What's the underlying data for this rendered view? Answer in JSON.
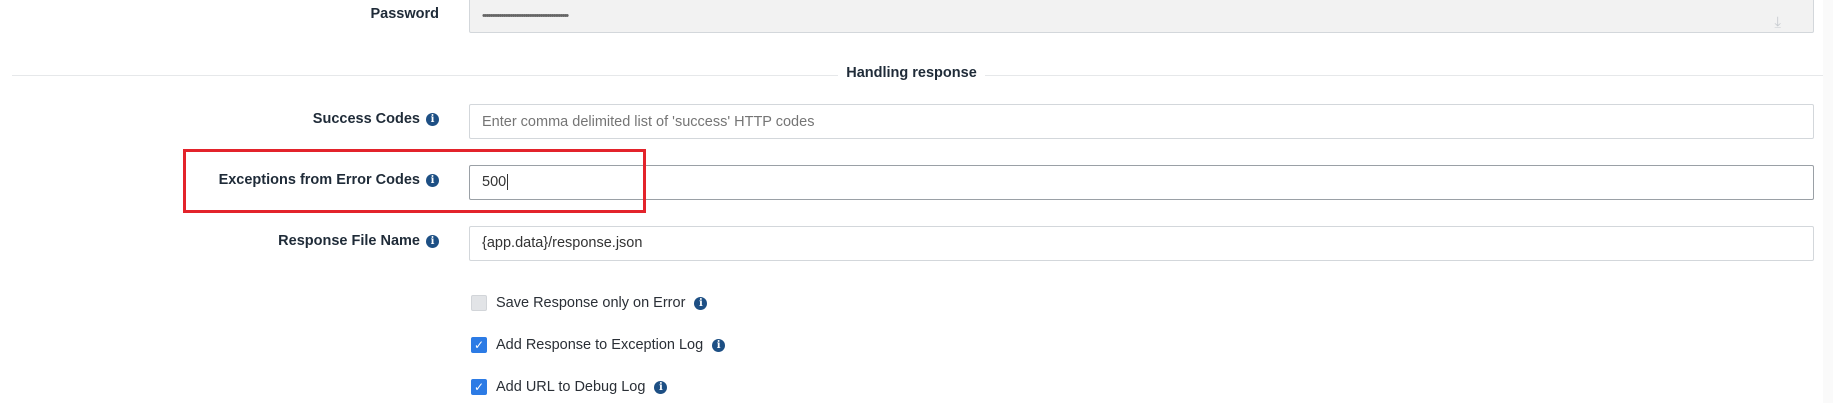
{
  "password": {
    "label": "Password",
    "value": "••••••••••••••••••••••••••••••••••••••••••••••"
  },
  "section": {
    "title": "Handling response"
  },
  "success_codes": {
    "label": "Success Codes",
    "placeholder": "Enter comma delimited list of 'success' HTTP codes",
    "value": ""
  },
  "exceptions": {
    "label": "Exceptions from Error Codes",
    "value": "500"
  },
  "response_file": {
    "label": "Response File Name",
    "value": "{app.data}/response.json"
  },
  "checkboxes": [
    {
      "label": "Save Response only on Error",
      "checked": false
    },
    {
      "label": "Add Response to Exception Log",
      "checked": true
    },
    {
      "label": "Add URL to Debug Log",
      "checked": true
    }
  ],
  "icons": {
    "info": "info-circle-icon",
    "password_toggle": "download-icon"
  },
  "colors": {
    "accent": "#2c7be5",
    "info": "#1d4f84",
    "highlight": "#e3232b"
  }
}
